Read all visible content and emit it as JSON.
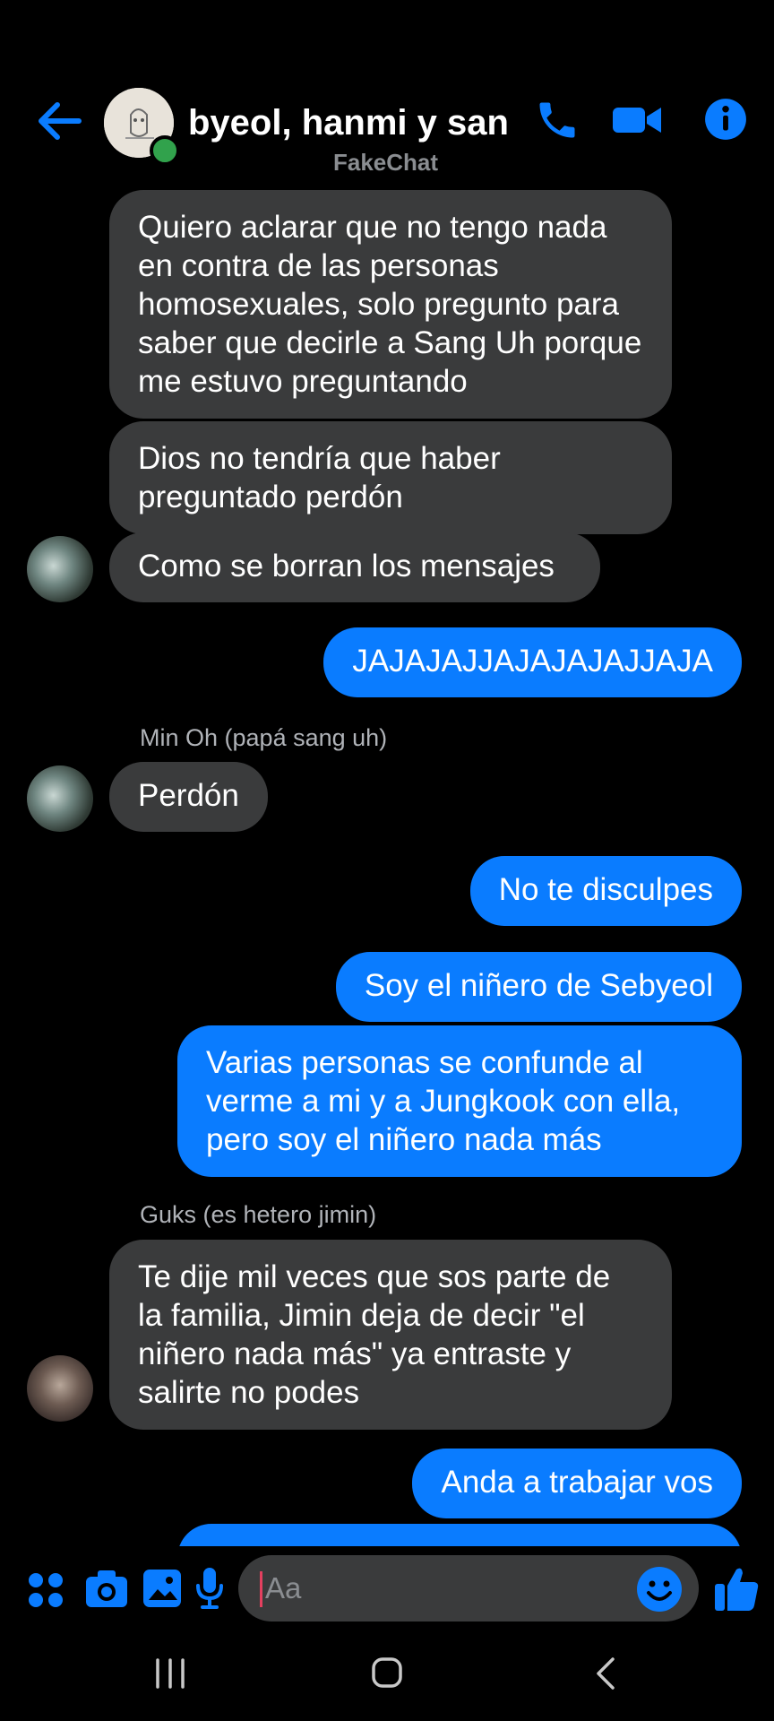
{
  "header": {
    "title": "byeol, hanmi y san…",
    "subtitle": "FakeChat",
    "accent": "#0a7cff",
    "icons": [
      "back-arrow-icon",
      "phone-icon",
      "video-camera-icon",
      "info-icon"
    ]
  },
  "messages": [
    {
      "side": "in",
      "text": "Quiero aclarar que no tengo nada en contra de las personas homosexuales, solo pregunto para saber que decirle a Sang Uh porque me estuvo preguntando"
    },
    {
      "side": "in",
      "text": "Dios no tendría que haber preguntado perdón"
    },
    {
      "side": "in",
      "text": "Como se borran los mensajes"
    },
    {
      "side": "out",
      "text": "JAJAJAJJAJAJAJAJJAJA"
    },
    {
      "side": "in",
      "sender": "Min Oh (papá sang uh)",
      "text": "Perdón"
    },
    {
      "side": "out",
      "text": "No te disculpes"
    },
    {
      "side": "out",
      "text": "Soy el niñero de Sebyeol"
    },
    {
      "side": "out",
      "text": "Varias personas se confunde al verme a mi y a Jungkook con ella, pero soy el niñero nada más"
    },
    {
      "side": "in",
      "sender": "Guks (es hetero jimin)",
      "text": "Te dije mil veces que sos parte de la familia, Jimin deja de decir \"el niñero nada más\" ya entraste y salirte no podes"
    },
    {
      "side": "out",
      "text": "Anda a trabajar vos"
    }
  ],
  "composer": {
    "placeholder": "Aa",
    "icons": [
      "apps-icon",
      "camera-icon",
      "gallery-icon",
      "microphone-icon",
      "emoji-icon",
      "thumbs-up-icon"
    ]
  },
  "system_nav": {
    "icons": [
      "recent-apps-icon",
      "home-icon",
      "back-icon"
    ]
  }
}
